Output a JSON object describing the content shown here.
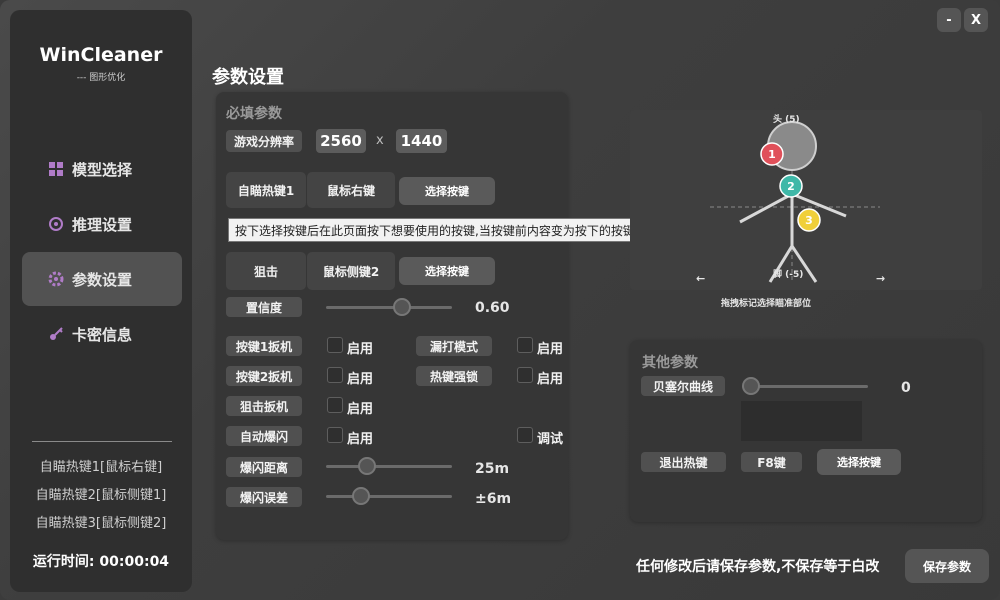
{
  "app": {
    "title": "WinCleaner",
    "subtitle": "--- 图形优化"
  },
  "window": {
    "minimize": "-",
    "close": "X"
  },
  "sidebar": {
    "items": [
      {
        "label": "模型选择",
        "icon": "grid-icon"
      },
      {
        "label": "推理设置",
        "icon": "cycle-icon"
      },
      {
        "label": "参数设置",
        "icon": "gear-icon"
      },
      {
        "label": "卡密信息",
        "icon": "key-icon"
      }
    ],
    "hotkeys": [
      "自瞄热键1[鼠标右键]",
      "自瞄热键2[鼠标侧键1]",
      "自瞄热键3[鼠标侧键2]"
    ],
    "runtime_label": "运行时间:",
    "runtime_value": "00:00:04"
  },
  "page": {
    "title": "参数设置"
  },
  "required": {
    "title": "必填参数",
    "resolution_label": "游戏分辨率",
    "res_w": "2560",
    "res_x": "x",
    "res_h": "1440",
    "aim1_label": "自瞄热键1",
    "aim1_key": "鼠标右键",
    "select_key": "选择按键",
    "snipe_label": "狙击",
    "snipe_key": "鼠标侧键2",
    "confidence_label": "置信度",
    "confidence_value": "0.60",
    "key1_trigger": "按键1扳机",
    "key2_trigger": "按键2扳机",
    "snipe_trigger": "狙击扳机",
    "auto_flash": "自动爆闪",
    "enable": "启用",
    "tap_mode": "漏打模式",
    "hotkey_lock": "热键强锁",
    "debug": "调试",
    "flash_distance_label": "爆闪距离",
    "flash_distance_value": "25m",
    "flash_error_label": "爆闪误差",
    "flash_error_value": "±6m"
  },
  "tooltip": "按下选择按键后在此页面按下想要使用的按键,当按键前内容变为按下的按键名时即使用成功!",
  "diagram": {
    "head_label": "头 (5)",
    "foot_label": "脚 (-5)",
    "hint": "拖拽标记选择瞄准部位",
    "left_arrow": "←",
    "right_arrow": "→",
    "markers": [
      {
        "label": "1",
        "color": "#e0505a"
      },
      {
        "label": "2",
        "color": "#3fb8a8"
      },
      {
        "label": "3",
        "color": "#f0cf3a"
      }
    ]
  },
  "other": {
    "title": "其他参数",
    "bezier_label": "贝塞尔曲线",
    "bezier_value": "0",
    "exit_hotkey_label": "退出热键",
    "exit_hotkey_value": "F8键",
    "select_key": "选择按键"
  },
  "sliders": {
    "confidence": 0.6,
    "flash_distance_fraction": 0.32,
    "flash_error_fraction": 0.28,
    "bezier_fraction": 0.0
  },
  "footer": {
    "note": "任何修改后请保存参数,不保存等于白改",
    "save": "保存参数"
  }
}
